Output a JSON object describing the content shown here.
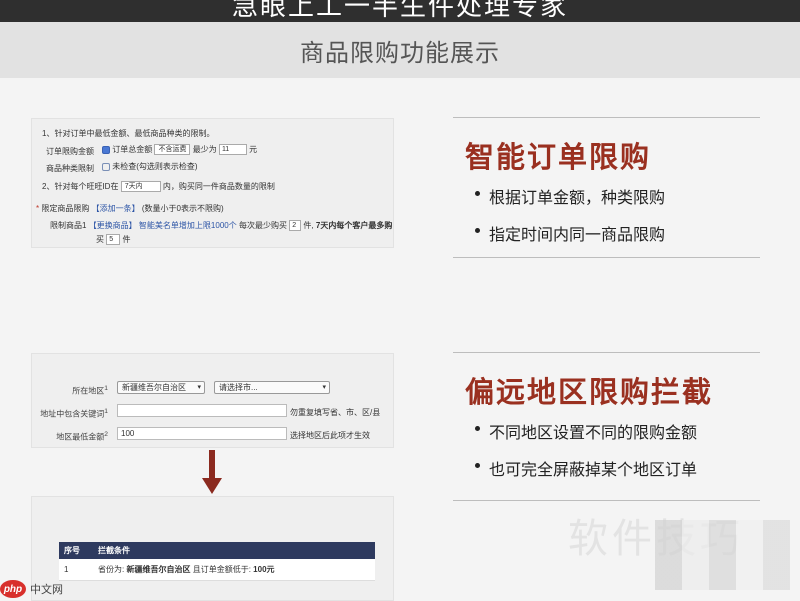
{
  "banner_title": "急眼上工一半生件处理专家",
  "page_title": "商品限购功能展示",
  "panel1": {
    "line1": "1、针对订单中最低金额、最低商品种类的限制。",
    "order_amount_label": "订单限购金额",
    "order_amount_checkbox": "订单总金额",
    "order_amount_select": "不含运费",
    "order_amount_min_label": "最少为",
    "order_amount_value": "11",
    "order_amount_unit": "元",
    "category_label": "商品种类限制",
    "category_text": "未检查(勾选则表示检查)",
    "line2": "2、针对每个旺旺ID在",
    "days_select": "7天内",
    "line2_suffix": "内，购买同一件商品数量的限制",
    "product_label": "限定商品限购",
    "add_link": "【添加一条】",
    "add_hint": "(数量小于0表示不限购)",
    "limit_label": "限制商品1",
    "change_link": "【更换商品】",
    "product_name": "智能美名单增加上限1000个",
    "per_label": "每次最少购买",
    "per_value": "2",
    "per_unit": "件,",
    "days_text": "7天内每个客户最多购",
    "buy_label": "买",
    "buy_value": "5",
    "buy_unit": "件"
  },
  "panel2": {
    "region_label": "所在地区",
    "region_sup": "1",
    "region_value": "新疆维吾尔自治区",
    "city_placeholder": "请选择市...",
    "keyword_label": "地址中包含关键词",
    "keyword_sup": "1",
    "keyword_hint": "勿重复填写省、市、区/县",
    "min_amount_label": "地区最低金额",
    "min_amount_sup": "2",
    "min_amount_value": "100",
    "min_amount_hint": "选择地区后此项才生效"
  },
  "panel3": {
    "columns": [
      "序号",
      "拦截条件"
    ],
    "row_index": "1",
    "row_prefix": "省份为:",
    "row_region": "新疆维吾尔自治区",
    "row_middle": "且订单金额低于:",
    "row_amount": "100元"
  },
  "feature1": {
    "title": "智能订单限购",
    "bullets": [
      "根据订单金额，种类限购",
      "指定时间内同一商品限购"
    ]
  },
  "feature2": {
    "title": "偏远地区限购拦截",
    "bullets": [
      "不同地区设置不同的限购金额",
      "也可完全屏蔽掉某个地区订单"
    ]
  },
  "watermark": "软件技巧",
  "logo": {
    "badge": "php",
    "site": "中文网"
  },
  "colors": {
    "accent": "#9a3020",
    "table_header": "#2e3a5f",
    "arrow": "#8b2a1f"
  }
}
